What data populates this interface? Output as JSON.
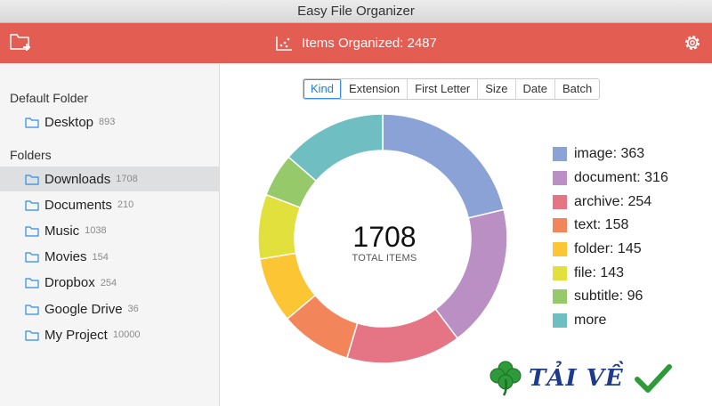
{
  "window": {
    "title": "Easy File Organizer"
  },
  "toolbar": {
    "status": "Items Organized: 2487"
  },
  "sidebar": {
    "default_title": "Default Folder",
    "default_item": {
      "label": "Desktop",
      "count": "893"
    },
    "folders_title": "Folders",
    "folders": [
      {
        "label": "Downloads",
        "count": "1708",
        "selected": true
      },
      {
        "label": "Documents",
        "count": "210"
      },
      {
        "label": "Music",
        "count": "1038"
      },
      {
        "label": "Movies",
        "count": "154"
      },
      {
        "label": "Dropbox",
        "count": "254"
      },
      {
        "label": "Google Drive",
        "count": "36"
      },
      {
        "label": "My Project",
        "count": "10000"
      }
    ]
  },
  "tabs": [
    {
      "label": "Kind",
      "active": true
    },
    {
      "label": "Extension"
    },
    {
      "label": "First Letter"
    },
    {
      "label": "Size"
    },
    {
      "label": "Date"
    },
    {
      "label": "Batch"
    }
  ],
  "chart_data": {
    "type": "pie",
    "donut": true,
    "center_value": "1708",
    "center_label": "TOTAL ITEMS",
    "legend_position": "right",
    "slices": [
      {
        "label": "image: 363",
        "value": 363,
        "color": "#8aa2d6"
      },
      {
        "label": "document: 316",
        "value": 316,
        "color": "#b98fc4"
      },
      {
        "label": "archive: 254",
        "value": 254,
        "color": "#e57584"
      },
      {
        "label": "text: 158",
        "value": 158,
        "color": "#f2865a"
      },
      {
        "label": "folder: 145",
        "value": 145,
        "color": "#fbc534"
      },
      {
        "label": "file: 143",
        "value": 143,
        "color": "#e2e03c"
      },
      {
        "label": "subtitle: 96",
        "value": 96,
        "color": "#95c96a"
      },
      {
        "label": "more",
        "value": 233,
        "color": "#6fbfc2"
      }
    ]
  },
  "watermark": {
    "text": "TẢI VỀ",
    "clover_color": "#2e9a3a",
    "check_color": "#2e9a3a"
  },
  "colors": {
    "accent": "#e35d53",
    "folder_icon": "#2d8de0",
    "tab_active": "#1a7fd6"
  }
}
